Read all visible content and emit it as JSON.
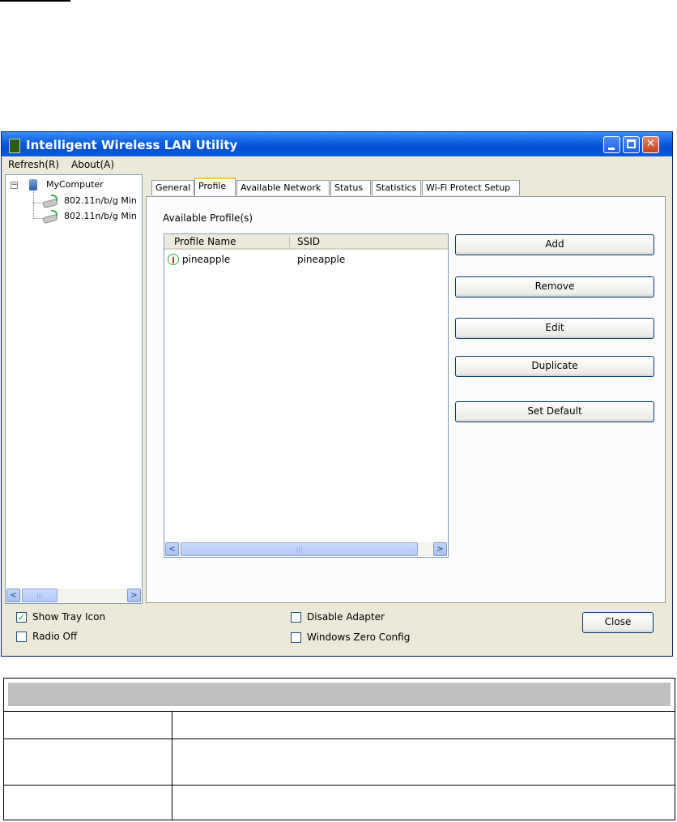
{
  "window": {
    "title": "Intelligent Wireless LAN Utility",
    "controls": [
      "minimize",
      "maximize",
      "close"
    ]
  },
  "menu": {
    "items": [
      {
        "label": "Refresh(R)"
      },
      {
        "label": "About(A)"
      }
    ]
  },
  "tree": {
    "root": "MyComputer",
    "adapters": [
      "802.11n/b/g Min",
      "802.11n/b/g Min"
    ]
  },
  "tabs": [
    {
      "label": "General"
    },
    {
      "label": "Profile",
      "active": true
    },
    {
      "label": "Available Network"
    },
    {
      "label": "Status"
    },
    {
      "label": "Statistics"
    },
    {
      "label": "Wi-Fi Protect Setup"
    }
  ],
  "profile": {
    "group_label": "Available Profile(s)",
    "columns": [
      "Profile Name",
      "SSID"
    ],
    "rows": [
      {
        "name": "pineapple",
        "ssid": "pineapple",
        "icon": "antenna-icon"
      }
    ],
    "buttons": [
      "Add",
      "Remove",
      "Edit",
      "Duplicate",
      "Set Default"
    ]
  },
  "options": {
    "show_tray_icon": {
      "label": "Show Tray Icon",
      "checked": true
    },
    "radio_off": {
      "label": "Radio Off",
      "checked": false
    },
    "disable_adapter": {
      "label": "Disable Adapter",
      "checked": false
    },
    "windows_zero_config": {
      "label": "Windows Zero Config",
      "checked": false
    }
  },
  "close_label": "Close",
  "colors": {
    "titlebar": "#0a5ee0",
    "dialog_bg": "#ece9d8",
    "active_tab_accent": "#ffc83c",
    "check_mark": "#21a121"
  }
}
